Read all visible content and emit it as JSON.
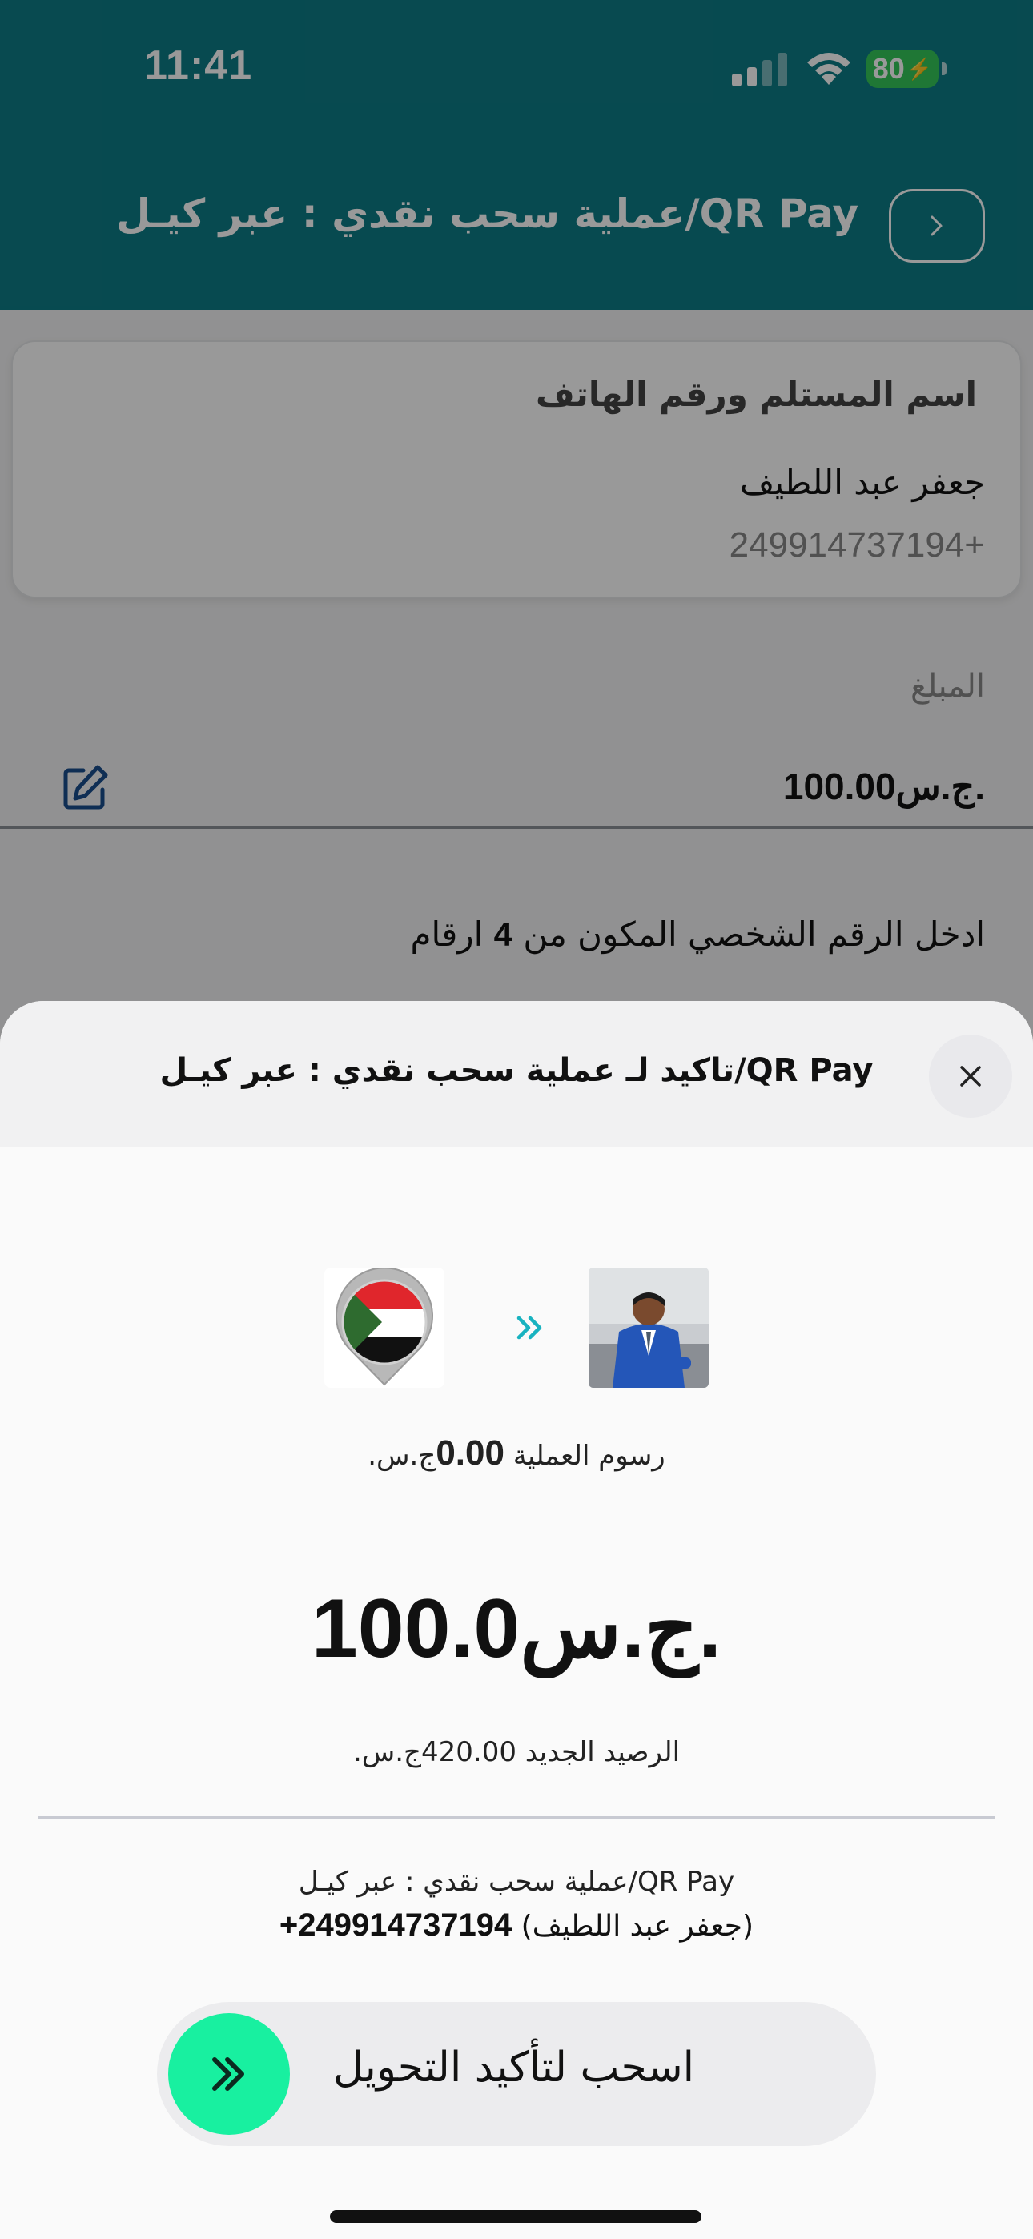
{
  "status_bar": {
    "time": "11:41",
    "battery": "80",
    "signal_icon": "cellular-signal-icon",
    "wifi_icon": "wifi-icon"
  },
  "header": {
    "title": "عملية سحب نقدي : عبر كيـل/QR Pay",
    "back_icon": "chevron-right-icon"
  },
  "recipient": {
    "section_title": "اسم المستلم ورقم الهاتف",
    "name": "جعفر عبد اللطيف",
    "phone": "249914737194+"
  },
  "amount": {
    "label": "المبلغ",
    "value": "100.00ج.س."
  },
  "pin": {
    "prompt_before": "ادخل الرقم الشخصي المكون من",
    "digits": "4",
    "prompt_after": "ارقام"
  },
  "sheet": {
    "title": "تاكيد لـ عملية سحب نقدي : عبر كيـل/QR Pay",
    "fee_label": "رسوم العملية",
    "fee_amount": "0.00",
    "fee_currency": "ج.س.",
    "big_amount": "100.0ج.س.",
    "new_balance": "الرصيد الجديد 420.00ج.س.",
    "summary_line1": "عملية سحب نقدي : عبر كيـل/QR Pay",
    "summary_name": "(جعفر عبد اللطيف)",
    "summary_phone": "249914737194+",
    "slide_label": "اسحب لتأكيد التحويل"
  },
  "colors": {
    "header": "#0d7c85",
    "knob": "#18f0a0",
    "arrows": "#19b3c0"
  }
}
